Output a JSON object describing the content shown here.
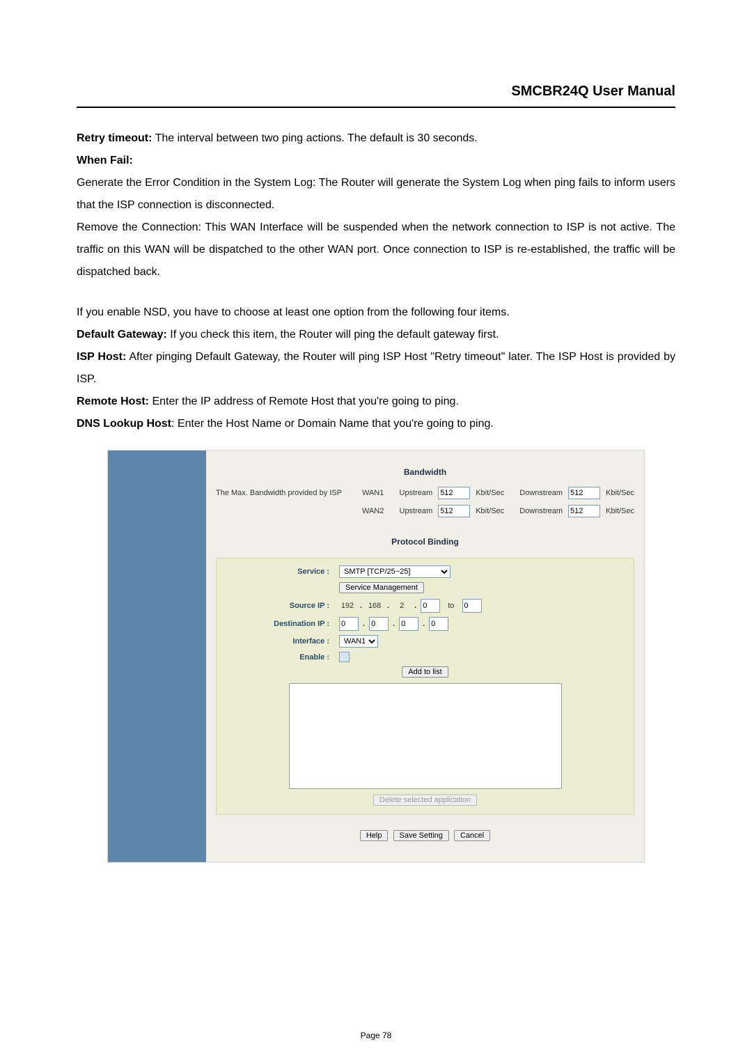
{
  "doc": {
    "title": "SMCBR24Q User Manual",
    "footer": "Page 78",
    "p1_b": "Retry timeout:",
    "p1_t": " The interval between two ping actions. The default is 30 seconds.",
    "p2_b": "When Fail:",
    "p3": "Generate the Error Condition in the System Log: The Router will generate the System Log when ping fails to inform users that the ISP connection is disconnected.",
    "p4": "Remove the Connection: This WAN Interface will be suspended when the network connection to ISP is not active. The traffic on this WAN will be dispatched to the other WAN port. Once connection to ISP is re-established, the traffic will be dispatched back.",
    "p5": "If you enable NSD, you have to choose at least one option from the following four items.",
    "p6_b": "Default Gateway:",
    "p6_t": " If you check this item, the Router will ping the default gateway first.",
    "p7_b": "ISP Host:",
    "p7_t": " After pinging Default Gateway, the Router will ping ISP Host \"Retry timeout\" later. The ISP Host is provided by ISP.",
    "p8_b": "Remote Host:",
    "p8_t": " Enter the IP address of Remote Host that you're going to ping.",
    "p9_b": "DNS Lookup Host",
    "p9_t": ": Enter the Host Name or Domain Name that you're going to ping."
  },
  "ui": {
    "bandwidth": {
      "title": "Bandwidth",
      "caption": "The Max. Bandwidth provided by ISP",
      "rows": [
        {
          "wan": "WAN1",
          "up_label": "Upstream",
          "up": "512",
          "unit": "Kbit/Sec",
          "down_label": "Downstream",
          "down": "512"
        },
        {
          "wan": "WAN2",
          "up_label": "Upstream",
          "up": "512",
          "unit": "Kbit/Sec",
          "down_label": "Downstream",
          "down": "512"
        }
      ]
    },
    "binding": {
      "title": "Protocol Binding",
      "labels": {
        "service": "Service :",
        "source": "Source IP :",
        "dest": "Destination IP :",
        "iface": "Interface :",
        "enable": "Enable :"
      },
      "service_value": "SMTP [TCP/25~25]",
      "service_mgmt": "Service Management",
      "source": {
        "a": "192",
        "b": "168",
        "c": "2",
        "d": "0",
        "to_label": "to",
        "to": "0"
      },
      "dest": {
        "a": "0",
        "b": "0",
        "c": "0",
        "d": "0"
      },
      "iface_value": "WAN1",
      "add_btn": "Add to list",
      "delete_btn": "Delete selected application"
    },
    "buttons": {
      "help": "Help",
      "save": "Save Setting",
      "cancel": "Cancel"
    }
  }
}
